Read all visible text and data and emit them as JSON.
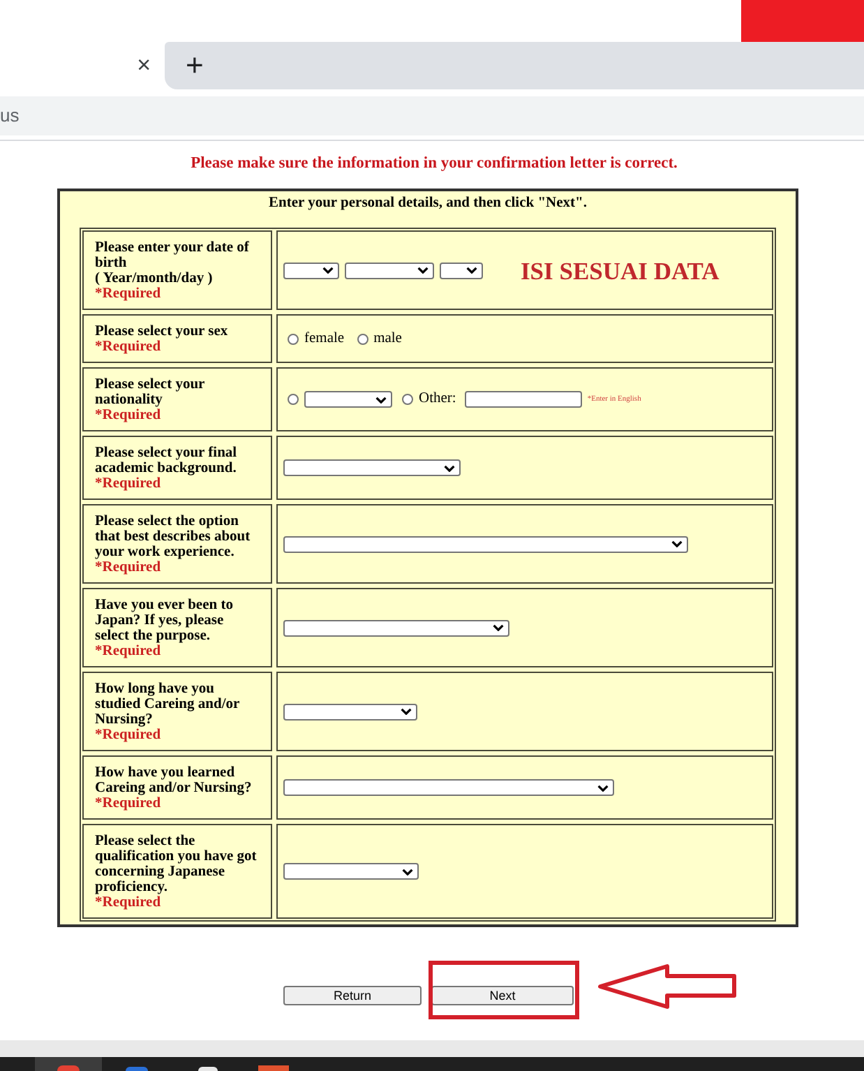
{
  "browser": {
    "tab_close": "×",
    "new_tab": "+",
    "address": "us"
  },
  "notice": "Please make sure the information in your confirmation letter is correct.",
  "form": {
    "heading": "Enter your personal details, and then click \"Next\".",
    "rows": [
      {
        "label": "Please enter your date of birth",
        "hint": "( Year/month/day )",
        "required": "*Required",
        "controls": [
          {
            "kind": "select"
          },
          {
            "kind": "select"
          },
          {
            "kind": "select"
          },
          {
            "kind": "annotation",
            "text": "ISI SESUAI DATA"
          }
        ]
      },
      {
        "label": "Please select your sex",
        "required": "*Required",
        "controls": [
          {
            "kind": "radio",
            "label": "female",
            "selected": false
          },
          {
            "kind": "radio",
            "label": "male",
            "selected": false
          }
        ]
      },
      {
        "label": "Please select your nationality",
        "required": "*Required",
        "controls": [
          {
            "kind": "radio",
            "selected": false
          },
          {
            "kind": "select"
          },
          {
            "kind": "radio",
            "label": "Other:",
            "selected": false
          },
          {
            "kind": "text"
          },
          {
            "kind": "note",
            "text": "*Enter in English"
          }
        ]
      },
      {
        "label": "Please select your final academic background.",
        "required": "*Required",
        "controls": [
          {
            "kind": "select"
          }
        ]
      },
      {
        "label": "Please select the option that best describes about your work experience.",
        "required": "*Required",
        "controls": [
          {
            "kind": "select"
          }
        ]
      },
      {
        "label": "Have you ever been to Japan? If yes, please select the purpose.",
        "required": "*Required",
        "controls": [
          {
            "kind": "select"
          }
        ]
      },
      {
        "label": "How long have you studied Careing and/or Nursing?",
        "required": "*Required",
        "controls": [
          {
            "kind": "select"
          }
        ]
      },
      {
        "label": "How have you learned Careing and/or Nursing?",
        "required": "*Required",
        "controls": [
          {
            "kind": "select"
          }
        ]
      },
      {
        "label": "Please select the qualification you have got concerning Japanese proficiency.",
        "required": "*Required",
        "controls": [
          {
            "kind": "select"
          }
        ]
      }
    ]
  },
  "buttons": [
    {
      "label": "Return",
      "highlighted": false
    },
    {
      "label": "Next",
      "highlighted": true
    }
  ]
}
